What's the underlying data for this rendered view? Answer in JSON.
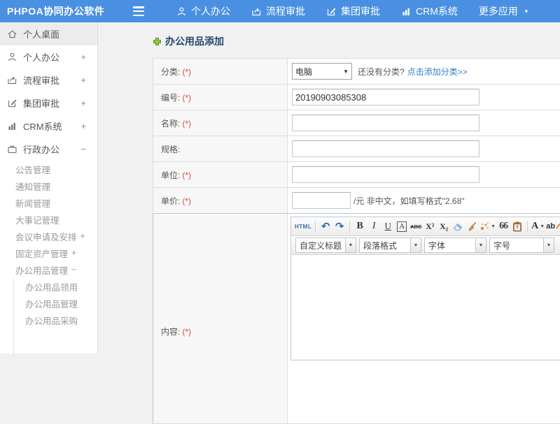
{
  "header": {
    "logo": "PHPOA协同办公软件",
    "nav": [
      {
        "label": "个人办公"
      },
      {
        "label": "流程审批"
      },
      {
        "label": "集团审批"
      },
      {
        "label": "CRM系统"
      },
      {
        "label": "更多应用"
      }
    ]
  },
  "sidebar": {
    "items": [
      {
        "label": "个人桌面",
        "expand": ""
      },
      {
        "label": "个人办公",
        "expand": "+"
      },
      {
        "label": "流程审批",
        "expand": "+"
      },
      {
        "label": "集团审批",
        "expand": "+"
      },
      {
        "label": "CRM系统",
        "expand": "+"
      },
      {
        "label": "行政办公",
        "expand": "−"
      }
    ],
    "sub_items": [
      {
        "label": "公告管理",
        "expand": ""
      },
      {
        "label": "通知管理",
        "expand": ""
      },
      {
        "label": "新闻管理",
        "expand": ""
      },
      {
        "label": "大事记管理",
        "expand": ""
      },
      {
        "label": "会议申请及安排",
        "expand": "+"
      },
      {
        "label": "固定资产管理",
        "expand": "+"
      },
      {
        "label": "办公用品管理",
        "expand": "−"
      }
    ],
    "sub_sub_items": [
      {
        "label": "办公用品领用"
      },
      {
        "label": "办公用品管理"
      },
      {
        "label": "办公用品采购"
      }
    ]
  },
  "page": {
    "title": "办公用品添加"
  },
  "form": {
    "category": {
      "label": "分类:",
      "required": "(*)",
      "selected": "电脑",
      "hint": "还没有分类?",
      "link": "点击添加分类>>"
    },
    "code": {
      "label": "编号:",
      "required": "(*)",
      "value": "20190903085308"
    },
    "name": {
      "label": "名称:",
      "required": "(*)"
    },
    "spec": {
      "label": "规格:"
    },
    "unit": {
      "label": "单位:",
      "required": "(*)"
    },
    "price": {
      "label": "单价:",
      "required": "(*)",
      "suffix": "/元 非中文，如填写格式\"2.68\""
    },
    "content": {
      "label": "内容:",
      "required": "(*)"
    }
  },
  "editor": {
    "buttons": {
      "html": "HTML",
      "undo": "↶",
      "redo": "↷",
      "bold": "B",
      "italic": "I",
      "underline": "U",
      "autotypeset": "A",
      "strikethrough": "ABC",
      "superscript": "X²",
      "subscript": "X₂",
      "blockquote": "66",
      "paste_text": "T",
      "fontcolor": "A",
      "highlight": "ab"
    },
    "dropdowns": [
      {
        "label": "自定义标题"
      },
      {
        "label": "段落格式"
      },
      {
        "label": "字体"
      },
      {
        "label": "字号"
      }
    ],
    "caret": "▼"
  }
}
